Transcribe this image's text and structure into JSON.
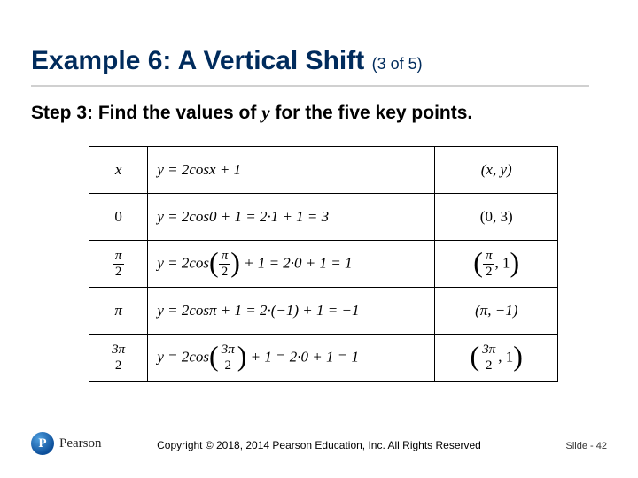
{
  "title": {
    "main": "Example 6: A Vertical Shift",
    "sub": "(3 of 5)"
  },
  "step": {
    "prefix": "Step 3: Find the values of ",
    "var": "y",
    "suffix": " for the five key points."
  },
  "table": {
    "header": {
      "col0": "x",
      "col1": "y = 2cosx + 1",
      "col2": "(x, y)"
    },
    "rows": [
      {
        "x_plain": "0",
        "x_frac": null,
        "eq": "y = 2cos0 + 1 = 2·1 + 1 = 3",
        "pt_plain": "(0, 3)",
        "pt_frac": null
      },
      {
        "x_plain": null,
        "x_frac": {
          "n": "π",
          "d": "2"
        },
        "eq_pre": "y = 2cos",
        "eq_frac": {
          "n": "π",
          "d": "2"
        },
        "eq_post": " + 1 = 2·0 + 1 = 1",
        "pt_frac": {
          "n": "π",
          "d": "2"
        },
        "pt_val": ", 1"
      },
      {
        "x_plain": "π",
        "x_frac": null,
        "eq": "y = 2cosπ + 1 = 2·(−1) + 1 = −1",
        "pt_plain": "(π, −1)",
        "pt_frac": null
      },
      {
        "x_plain": null,
        "x_frac": {
          "n": "3π",
          "d": "2"
        },
        "eq_pre": "y = 2cos",
        "eq_frac": {
          "n": "3π",
          "d": "2"
        },
        "eq_post": " + 1 = 2·0 + 1 = 1",
        "pt_frac": {
          "n": "3π",
          "d": "2"
        },
        "pt_val": ", 1"
      }
    ]
  },
  "footer": {
    "logoLetter": "P",
    "brand": "Pearson",
    "copyright": "Copyright © 2018, 2014 Pearson Education, Inc. All Rights Reserved",
    "slide": "Slide - 42"
  },
  "chart_data": {
    "type": "table",
    "columns": [
      "x",
      "y = 2cos x + 1",
      "(x, y)"
    ],
    "rows": [
      [
        "0",
        "y = 2cos0 + 1 = 2·1 + 1 = 3",
        "(0, 3)"
      ],
      [
        "π/2",
        "y = 2cos(π/2) + 1 = 2·0 + 1 = 1",
        "(π/2, 1)"
      ],
      [
        "π",
        "y = 2cosπ + 1 = 2·(−1) + 1 = −1",
        "(π, −1)"
      ],
      [
        "3π/2",
        "y = 2cos(3π/2) + 1 = 2·0 + 1 = 1",
        "(3π/2, 1)"
      ]
    ]
  }
}
